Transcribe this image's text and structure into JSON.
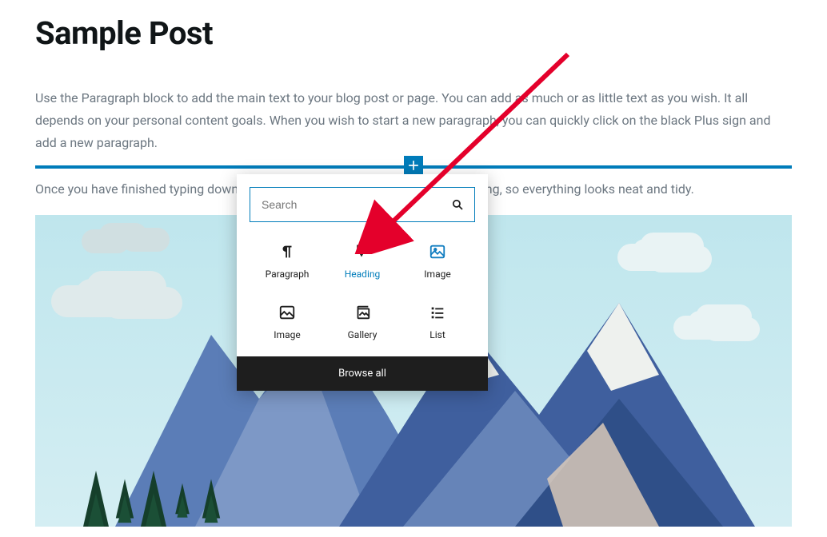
{
  "post": {
    "title": "Sample Post",
    "paragraph1": "Use the Paragraph block to add the main text to your blog post or page. You can add as much or as little text as you wish. It all depends on your personal content goals. When you wish to start a new paragraph, you can quickly click on the black Plus sign and add a new paragraph.",
    "paragraph2": "Once you have finished typing down the body of content, it's time to add a heading, so everything looks neat and tidy."
  },
  "inserter": {
    "search_placeholder": "Search",
    "blocks": [
      {
        "label": "Paragraph",
        "icon": "paragraph-icon"
      },
      {
        "label": "Heading",
        "icon": "heading-icon",
        "active": true
      },
      {
        "label": "Image",
        "icon": "image-icon",
        "blue": true
      },
      {
        "label": "Image",
        "icon": "image-icon"
      },
      {
        "label": "Gallery",
        "icon": "gallery-icon"
      },
      {
        "label": "List",
        "icon": "list-icon"
      }
    ],
    "browse_all": "Browse all"
  }
}
